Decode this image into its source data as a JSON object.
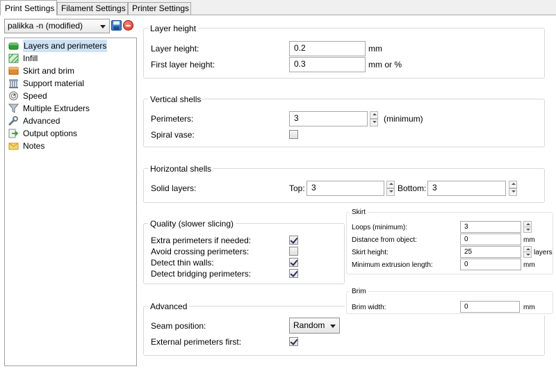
{
  "tabs": [
    {
      "label": "Print Settings",
      "active": true
    },
    {
      "label": "Filament Settings",
      "active": false
    },
    {
      "label": "Printer Settings",
      "active": false
    }
  ],
  "preset": {
    "selected": "palikka -n (modified)"
  },
  "tree": [
    {
      "label": "Layers and perimeters",
      "icon": "layers-icon",
      "selected": true
    },
    {
      "label": "Infill",
      "icon": "infill-icon"
    },
    {
      "label": "Skirt and brim",
      "icon": "skirt-brim-icon"
    },
    {
      "label": "Support material",
      "icon": "support-material-icon"
    },
    {
      "label": "Speed",
      "icon": "speed-icon"
    },
    {
      "label": "Multiple Extruders",
      "icon": "funnel-icon"
    },
    {
      "label": "Advanced",
      "icon": "wrench-icon"
    },
    {
      "label": "Output options",
      "icon": "output-arrow-icon"
    },
    {
      "label": "Notes",
      "icon": "notes-icon"
    }
  ],
  "layer_height": {
    "title": "Layer height",
    "layer_height_label": "Layer height:",
    "layer_height_value": "0.2",
    "layer_height_unit": "mm",
    "first_layer_label": "First layer height:",
    "first_layer_value": "0.3",
    "first_layer_unit": "mm or %"
  },
  "vertical_shells": {
    "title": "Vertical shells",
    "perimeters_label": "Perimeters:",
    "perimeters_value": "3",
    "perimeters_unit": "(minimum)",
    "spiral_label": "Spiral vase:",
    "spiral_checked": false
  },
  "horizontal_shells": {
    "title": "Horizontal shells",
    "solid_label": "Solid layers:",
    "top_label": "Top:",
    "top_value": "3",
    "bottom_label": "Bottom:",
    "bottom_value": "3"
  },
  "quality": {
    "title": "Quality (slower slicing)",
    "items": [
      {
        "label": "Extra perimeters if needed:",
        "checked": true
      },
      {
        "label": "Avoid crossing perimeters:",
        "checked": false
      },
      {
        "label": "Detect thin walls:",
        "checked": true
      },
      {
        "label": "Detect bridging perimeters:",
        "checked": true
      }
    ]
  },
  "advanced": {
    "title": "Advanced",
    "seam_label": "Seam position:",
    "seam_value": "Random",
    "ext_label": "External perimeters first:",
    "ext_checked": true
  },
  "skirt": {
    "title": "Skirt",
    "loops_label": "Loops (minimum):",
    "loops_value": "3",
    "distance_label": "Distance from object:",
    "distance_value": "0",
    "distance_unit": "mm",
    "height_label": "Skirt height:",
    "height_value": "25",
    "height_unit": "layers",
    "minlen_label": "Minimum extrusion length:",
    "minlen_value": "0",
    "minlen_unit": "mm"
  },
  "brim": {
    "title": "Brim",
    "width_label": "Brim width:",
    "width_value": "0",
    "width_unit": "mm"
  }
}
